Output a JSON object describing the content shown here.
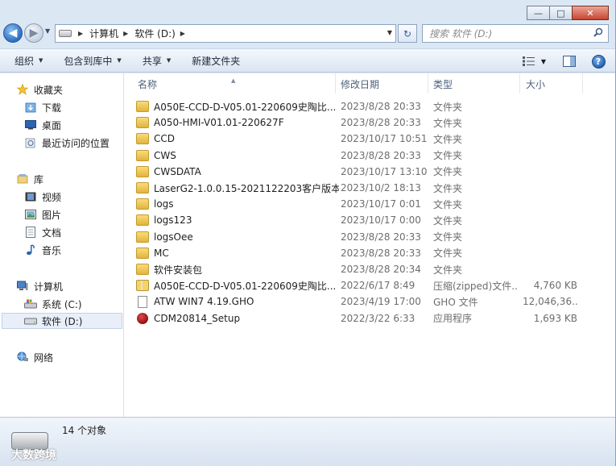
{
  "window": {
    "caption": {
      "minimize": "—",
      "maximize": "□",
      "close": "✕"
    }
  },
  "address": {
    "breadcrumbs": [
      "计算机",
      "软件 (D:)"
    ]
  },
  "search": {
    "placeholder": "搜索 软件 (D:)"
  },
  "toolbar": {
    "organize": "组织",
    "include_in_library": "包含到库中",
    "share": "共享",
    "new_folder": "新建文件夹"
  },
  "nav": {
    "favorites": "收藏夹",
    "downloads": "下载",
    "desktop": "桌面",
    "recent": "最近访问的位置",
    "libraries": "库",
    "videos": "视频",
    "pictures": "图片",
    "documents": "文档",
    "music": "音乐",
    "computer": "计算机",
    "system_c": "系统 (C:)",
    "software_d": "软件 (D:)",
    "network": "网络"
  },
  "columns": {
    "name": "名称",
    "date": "修改日期",
    "type": "类型",
    "size": "大小"
  },
  "files": [
    {
      "name": "A050E-CCD-D-V05.01-220609史陶比...",
      "date": "2023/8/28 20:33",
      "type": "文件夹",
      "size": "",
      "icon": "folder-icon"
    },
    {
      "name": "A050-HMI-V01.01-220627F",
      "date": "2023/8/28 20:33",
      "type": "文件夹",
      "size": "",
      "icon": "folder-icon"
    },
    {
      "name": "CCD",
      "date": "2023/10/17 10:51",
      "type": "文件夹",
      "size": "",
      "icon": "folder-icon"
    },
    {
      "name": "CWS",
      "date": "2023/8/28 20:33",
      "type": "文件夹",
      "size": "",
      "icon": "folder-icon"
    },
    {
      "name": "CWSDATA",
      "date": "2023/10/17 13:10",
      "type": "文件夹",
      "size": "",
      "icon": "folder-icon"
    },
    {
      "name": "LaserG2-1.0.0.15-2021122203客户版本",
      "date": "2023/10/2 18:13",
      "type": "文件夹",
      "size": "",
      "icon": "folder-icon"
    },
    {
      "name": "logs",
      "date": "2023/10/17 0:01",
      "type": "文件夹",
      "size": "",
      "icon": "folder-icon"
    },
    {
      "name": "logs123",
      "date": "2023/10/17 0:00",
      "type": "文件夹",
      "size": "",
      "icon": "folder-icon"
    },
    {
      "name": "logsOee",
      "date": "2023/8/28 20:33",
      "type": "文件夹",
      "size": "",
      "icon": "folder-icon"
    },
    {
      "name": "MC",
      "date": "2023/8/28 20:33",
      "type": "文件夹",
      "size": "",
      "icon": "folder-icon"
    },
    {
      "name": "软件安装包",
      "date": "2023/8/28 20:34",
      "type": "文件夹",
      "size": "",
      "icon": "folder-icon"
    },
    {
      "name": "A050E-CCD-D-V05.01-220609史陶比...",
      "date": "2022/6/17 8:49",
      "type": "压缩(zipped)文件...",
      "size": "4,760 KB",
      "icon": "zip-icon"
    },
    {
      "name": "ATW WIN7 4.19.GHO",
      "date": "2023/4/19 17:00",
      "type": "GHO 文件",
      "size": "12,046,36...",
      "icon": "file-icon"
    },
    {
      "name": "CDM20814_Setup",
      "date": "2022/3/22 6:33",
      "type": "应用程序",
      "size": "1,693 KB",
      "icon": "app-icon"
    }
  ],
  "details": {
    "item_count": "14 个对象",
    "watermark": "大数跨境"
  }
}
